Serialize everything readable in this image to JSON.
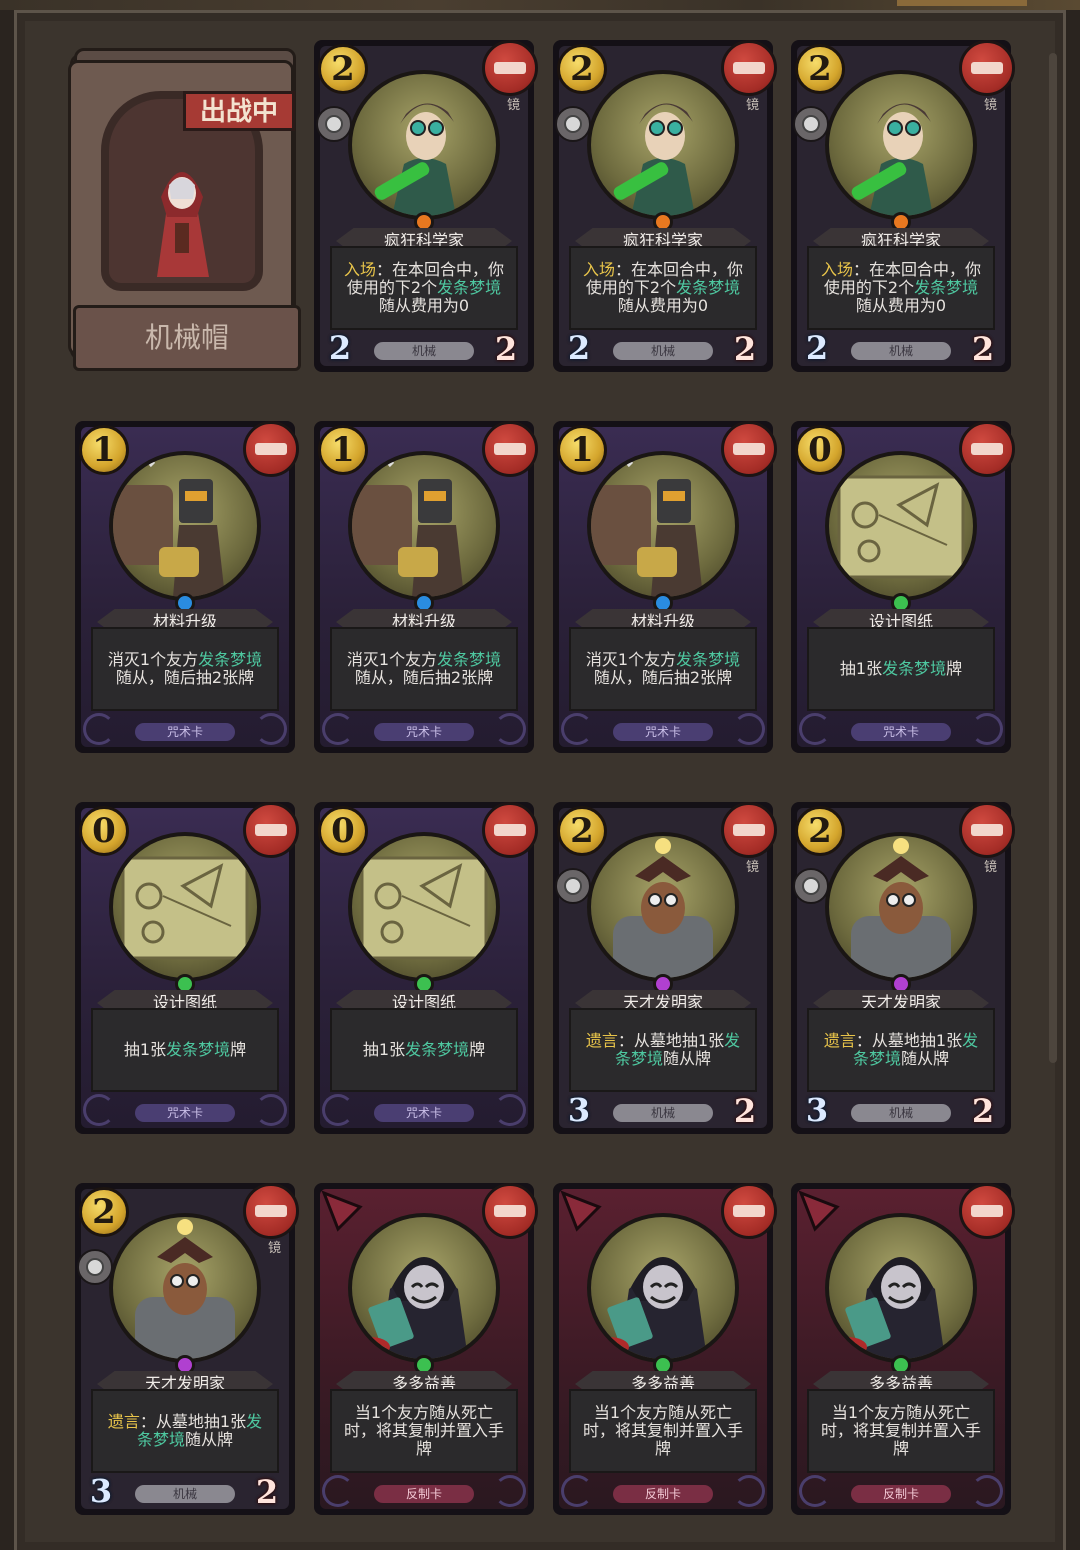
{
  "hero": {
    "name": "机械帽",
    "status": "出战中"
  },
  "colors": {
    "mana": "#e0b030",
    "remove": "#b8342c",
    "keyword_yellow": "#e8c44a",
    "keyword_green": "#4ec8a0"
  },
  "cards": [
    {
      "cost": "2",
      "title": "疯狂科学家",
      "kind": "minion",
      "frame": "grey",
      "tag": "镜",
      "gem": "#e87820",
      "desc_parts": [
        {
          "t": "入场",
          "c": "y"
        },
        {
          "t": "：在本回合中，你使用的下"
        },
        {
          "t": "2"
        },
        {
          "t": "个"
        },
        {
          "t": "发条梦境",
          "c": "g"
        },
        {
          "t": "随从费用为0"
        }
      ],
      "type": "机械",
      "atk": "2",
      "hp": "2"
    },
    {
      "cost": "2",
      "title": "疯狂科学家",
      "kind": "minion",
      "frame": "grey",
      "tag": "镜",
      "gem": "#e87820",
      "desc_parts": [
        {
          "t": "入场",
          "c": "y"
        },
        {
          "t": "：在本回合中，你使用的下"
        },
        {
          "t": "2"
        },
        {
          "t": "个"
        },
        {
          "t": "发条梦境",
          "c": "g"
        },
        {
          "t": "随从费用为0"
        }
      ],
      "type": "机械",
      "atk": "2",
      "hp": "2"
    },
    {
      "cost": "2",
      "title": "疯狂科学家",
      "kind": "minion",
      "frame": "grey",
      "tag": "镜",
      "gem": "#e87820",
      "desc_parts": [
        {
          "t": "入场",
          "c": "y"
        },
        {
          "t": "：在本回合中，你使用的下"
        },
        {
          "t": "2"
        },
        {
          "t": "个"
        },
        {
          "t": "发条梦境",
          "c": "g"
        },
        {
          "t": "随从费用为0"
        }
      ],
      "type": "机械",
      "atk": "2",
      "hp": "2"
    },
    {
      "cost": "1",
      "title": "材料升级",
      "kind": "spell",
      "frame": "purple",
      "gem": "#2a8ce0",
      "desc_parts": [
        {
          "t": "消灭1个友方"
        },
        {
          "t": "发条梦境",
          "c": "g"
        },
        {
          "t": "随从，随后抽2张牌"
        }
      ],
      "type": "咒术卡"
    },
    {
      "cost": "1",
      "title": "材料升级",
      "kind": "spell",
      "frame": "purple",
      "gem": "#2a8ce0",
      "desc_parts": [
        {
          "t": "消灭1个友方"
        },
        {
          "t": "发条梦境",
          "c": "g"
        },
        {
          "t": "随从，随后抽2张牌"
        }
      ],
      "type": "咒术卡"
    },
    {
      "cost": "1",
      "title": "材料升级",
      "kind": "spell",
      "frame": "purple",
      "gem": "#2a8ce0",
      "desc_parts": [
        {
          "t": "消灭1个友方"
        },
        {
          "t": "发条梦境",
          "c": "g"
        },
        {
          "t": "随从，随后抽2张牌"
        }
      ],
      "type": "咒术卡"
    },
    {
      "cost": "0",
      "title": "设计图纸",
      "kind": "spell",
      "frame": "purple",
      "gem": "#3cc050",
      "desc_parts": [
        {
          "t": "抽1张"
        },
        {
          "t": "发条梦境",
          "c": "g"
        },
        {
          "t": "牌"
        }
      ],
      "type": "咒术卡"
    },
    {
      "cost": "0",
      "title": "设计图纸",
      "kind": "spell",
      "frame": "purple",
      "gem": "#3cc050",
      "desc_parts": [
        {
          "t": "抽1张"
        },
        {
          "t": "发条梦境",
          "c": "g"
        },
        {
          "t": "牌"
        }
      ],
      "type": "咒术卡"
    },
    {
      "cost": "0",
      "title": "设计图纸",
      "kind": "spell",
      "frame": "purple",
      "gem": "#3cc050",
      "desc_parts": [
        {
          "t": "抽1张"
        },
        {
          "t": "发条梦境",
          "c": "g"
        },
        {
          "t": "牌"
        }
      ],
      "type": "咒术卡"
    },
    {
      "cost": "2",
      "title": "天才发明家",
      "kind": "minion",
      "frame": "grey",
      "tag": "镜",
      "gem": "#b040d0",
      "desc_parts": [
        {
          "t": "遗言",
          "c": "y"
        },
        {
          "t": "：从墓地抽1张"
        },
        {
          "t": "发条梦境",
          "c": "g"
        },
        {
          "t": "随从牌"
        }
      ],
      "type": "机械",
      "atk": "3",
      "hp": "2"
    },
    {
      "cost": "2",
      "title": "天才发明家",
      "kind": "minion",
      "frame": "grey",
      "tag": "镜",
      "gem": "#b040d0",
      "desc_parts": [
        {
          "t": "遗言",
          "c": "y"
        },
        {
          "t": "：从墓地抽1张"
        },
        {
          "t": "发条梦境",
          "c": "g"
        },
        {
          "t": "随从牌"
        }
      ],
      "type": "机械",
      "atk": "3",
      "hp": "2"
    },
    {
      "cost": "2",
      "title": "天才发明家",
      "kind": "minion",
      "frame": "grey",
      "tag": "镜",
      "gem": "#b040d0",
      "desc_parts": [
        {
          "t": "遗言",
          "c": "y"
        },
        {
          "t": "：从墓地抽1张"
        },
        {
          "t": "发条梦境",
          "c": "g"
        },
        {
          "t": "随从牌"
        }
      ],
      "type": "机械",
      "atk": "3",
      "hp": "2"
    },
    {
      "cost": "",
      "title": "多多益善",
      "kind": "counter",
      "frame": "red",
      "gem": "#3cc050",
      "desc_parts": [
        {
          "t": "当1个友方随从死亡时，将其复制并置入手牌"
        }
      ],
      "type": "反制卡"
    },
    {
      "cost": "",
      "title": "多多益善",
      "kind": "counter",
      "frame": "red",
      "gem": "#3cc050",
      "desc_parts": [
        {
          "t": "当1个友方随从死亡时，将其复制并置入手牌"
        }
      ],
      "type": "反制卡"
    },
    {
      "cost": "",
      "title": "多多益善",
      "kind": "counter",
      "frame": "red",
      "gem": "#3cc050",
      "desc_parts": [
        {
          "t": "当1个友方随从死亡时，将其复制并置入手牌"
        }
      ],
      "type": "反制卡"
    }
  ]
}
